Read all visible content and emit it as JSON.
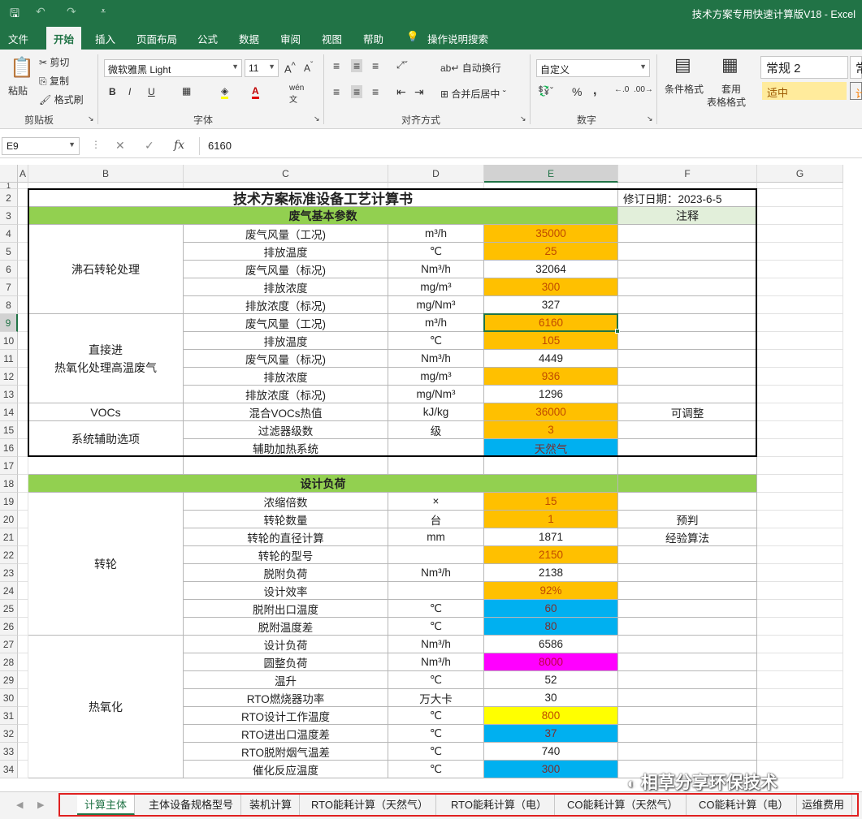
{
  "window": {
    "title": "技术方案专用快速计算版V18  -  Excel"
  },
  "menu": [
    "文件",
    "开始",
    "插入",
    "页面布局",
    "公式",
    "数据",
    "审阅",
    "视图",
    "帮助",
    "操作说明搜索"
  ],
  "ribbon": {
    "clipboard": {
      "paste": "粘贴",
      "cut": "剪切",
      "copy": "复制",
      "format_painter": "格式刷",
      "label": "剪贴板"
    },
    "font": {
      "name": "微软雅黑 Light",
      "size": "11",
      "label": "字体",
      "bold": "B",
      "italic": "I",
      "underline": "U"
    },
    "alignment": {
      "wrap": "自动换行",
      "merge": "合并后居中",
      "label": "对齐方式"
    },
    "number": {
      "format": "自定义",
      "percent": "%",
      "comma": ",",
      "label": "数字"
    },
    "styles": {
      "conditional": "条件格式",
      "table_format_1": "套用",
      "table_format_2": "表格格式",
      "normal": "常规 2",
      "neutral": "适中",
      "normal_cut": "常",
      "neutral_cut": "计"
    }
  },
  "formula_bar": {
    "name_box": "E9",
    "value": "6160"
  },
  "columns": [
    {
      "letter": "A",
      "sel": false
    },
    {
      "letter": "B",
      "sel": false
    },
    {
      "letter": "C",
      "sel": false
    },
    {
      "letter": "D",
      "sel": false
    },
    {
      "letter": "E",
      "sel": true
    },
    {
      "letter": "F",
      "sel": false
    },
    {
      "letter": "G",
      "sel": false
    }
  ],
  "rows": [
    "1",
    "2",
    "3",
    "4",
    "5",
    "6",
    "7",
    "8",
    "9",
    "10",
    "11",
    "12",
    "13",
    "14",
    "15",
    "16",
    "17",
    "18",
    "19",
    "20",
    "21",
    "22",
    "23",
    "24",
    "25",
    "26",
    "27",
    "28",
    "29",
    "30",
    "31",
    "32",
    "33",
    "34"
  ],
  "sheet": {
    "title": "技术方案标准设备工艺计算书",
    "revision": "修订日期：2023-6-5",
    "section1": "废气基本参数",
    "note_header": "注释",
    "section2": "设计负荷",
    "groups": {
      "zeolite": "沸石转轮处理",
      "direct": "直接进\n热氧化处理高温废气",
      "vocs": "VOCs",
      "aux": "系统辅助选项",
      "rotor": "转轮",
      "thermal": "热氧化"
    },
    "table1": [
      {
        "param": "废气风量（工况)",
        "unit": "m³/h",
        "value": "35000",
        "style": "orange",
        "note": ""
      },
      {
        "param": "排放温度",
        "unit": "℃",
        "value": "25",
        "style": "orange",
        "note": ""
      },
      {
        "param": "废气风量（标况)",
        "unit": "Nm³/h",
        "value": "32064",
        "style": "",
        "note": ""
      },
      {
        "param": "排放浓度",
        "unit": "mg/m³",
        "value": "300",
        "style": "orange",
        "note": ""
      },
      {
        "param": "排放浓度（标况)",
        "unit": "mg/Nm³",
        "value": "327",
        "style": "",
        "note": ""
      },
      {
        "param": "废气风量（工况)",
        "unit": "m³/h",
        "value": "6160",
        "style": "orange",
        "note": ""
      },
      {
        "param": "排放温度",
        "unit": "℃",
        "value": "105",
        "style": "orange",
        "note": ""
      },
      {
        "param": "废气风量（标况)",
        "unit": "Nm³/h",
        "value": "4449",
        "style": "",
        "note": ""
      },
      {
        "param": "排放浓度",
        "unit": "mg/m³",
        "value": "936",
        "style": "orange",
        "note": ""
      },
      {
        "param": "排放浓度（标况)",
        "unit": "mg/Nm³",
        "value": "1296",
        "style": "",
        "note": ""
      },
      {
        "param": "混合VOCs热值",
        "unit": "kJ/kg",
        "value": "36000",
        "style": "orange",
        "note": "可调整"
      },
      {
        "param": "过滤器级数",
        "unit": "级",
        "value": "3",
        "style": "orange",
        "note": ""
      },
      {
        "param": "辅助加热系统",
        "unit": "",
        "value": "天然气",
        "style": "blue",
        "note": ""
      }
    ],
    "table2": [
      {
        "param": "浓缩倍数",
        "unit": "×",
        "value": "15",
        "style": "orange",
        "note": ""
      },
      {
        "param": "转轮数量",
        "unit": "台",
        "value": "1",
        "style": "orange",
        "note": "预判"
      },
      {
        "param": "转轮的直径计算",
        "unit": "mm",
        "value": "1871",
        "style": "",
        "note": "经验算法"
      },
      {
        "param": "转轮的型号",
        "unit": "",
        "value": "2150",
        "style": "orange",
        "note": ""
      },
      {
        "param": "脱附负荷",
        "unit": "Nm³/h",
        "value": "2138",
        "style": "",
        "note": ""
      },
      {
        "param": "设计效率",
        "unit": "",
        "value": "92%",
        "style": "orange",
        "note": ""
      },
      {
        "param": "脱附出口温度",
        "unit": "℃",
        "value": "60",
        "style": "blue",
        "note": ""
      },
      {
        "param": "脱附温度差",
        "unit": "℃",
        "value": "80",
        "style": "blue",
        "note": ""
      },
      {
        "param": "设计负荷",
        "unit": "Nm³/h",
        "value": "6586",
        "style": "",
        "note": ""
      },
      {
        "param": "圆整负荷",
        "unit": "Nm³/h",
        "value": "8000",
        "style": "magenta",
        "note": ""
      },
      {
        "param": "温升",
        "unit": "℃",
        "value": "52",
        "style": "",
        "note": ""
      },
      {
        "param": "RTO燃烧器功率",
        "unit": "万大卡",
        "value": "30",
        "style": "",
        "note": ""
      },
      {
        "param": "RTO设计工作温度",
        "unit": "℃",
        "value": "800",
        "style": "yellow",
        "note": ""
      },
      {
        "param": "RTO进出口温度差",
        "unit": "℃",
        "value": "37",
        "style": "blue",
        "note": ""
      },
      {
        "param": "RTO脱附烟气温差",
        "unit": "℃",
        "value": "740",
        "style": "",
        "note": ""
      },
      {
        "param": "催化反应温度",
        "unit": "℃",
        "value": "300",
        "style": "blue",
        "note": ""
      }
    ]
  },
  "sheet_tabs": [
    "计算主体",
    "主体设备规格型号",
    "装机计算",
    "RTO能耗计算（天然气）",
    "RTO能耗计算（电）",
    "CO能耗计算（天然气）",
    "CO能耗计算（电）",
    "运维费用"
  ],
  "watermark": "相草分享环保技术",
  "colors": {
    "excel_green": "#217346",
    "header_green": "#92d050",
    "note_green": "#e2efda",
    "orange": "#ffc000",
    "blue": "#00b0f0",
    "magenta": "#ff00ff",
    "yellow": "#ffff00",
    "tab_frame": "#e02020"
  }
}
